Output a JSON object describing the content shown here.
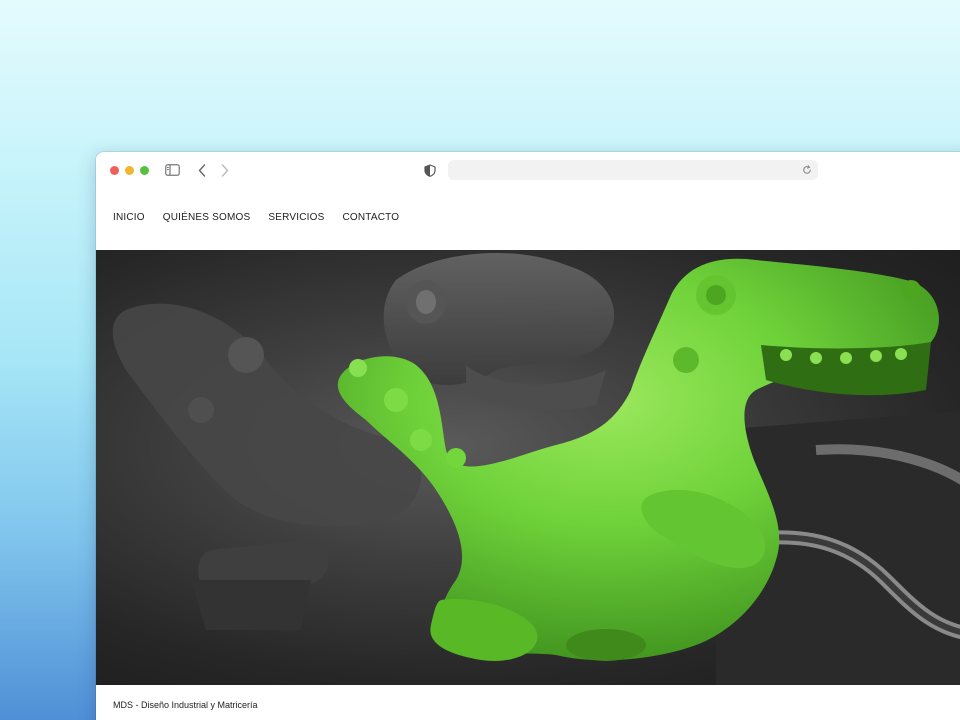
{
  "browser": {
    "url": "",
    "icons": [
      "sidebar-icon",
      "chevron-left-icon",
      "chevron-right-icon",
      "shield-icon",
      "reload-icon"
    ]
  },
  "nav": {
    "items": [
      {
        "label": "INICIO"
      },
      {
        "label": "QUIÉNES SOMOS"
      },
      {
        "label": "SERVICIOS"
      },
      {
        "label": "CONTACTO"
      }
    ]
  },
  "hero": {
    "image": "green-dinosaur-toy-render",
    "accent": "#6fd23a"
  },
  "footer": {
    "text": "MDS - Diseño Industrial y Matricería"
  }
}
